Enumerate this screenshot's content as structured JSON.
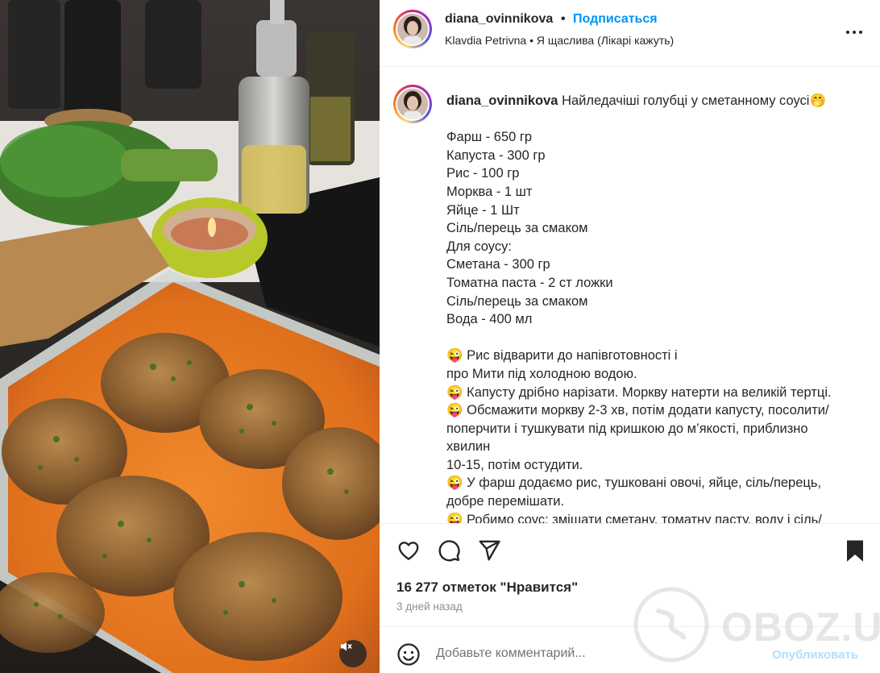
{
  "header": {
    "username": "diana_ovinnikova",
    "separator": "•",
    "follow_label": "Подписаться",
    "audio_artist": "Klavdia Petrivna",
    "audio_separator": "•",
    "audio_title": "Я щаслива (Лікарі кажуть)",
    "more_icon": "more-horizontal-icon"
  },
  "caption": {
    "username": "diana_ovinnikova",
    "title": "Найледачіші голубці у сметанному соусі🤭",
    "text": "Фарш - 650 гр\nКапуста - 300 гр\nРис - 100 гр\nМорква - 1 шт\nЯйце - 1 Шт\nСіль/перець за смаком\nДля соусу:\nСметана - 300 гр\nТоматна паста - 2 ст ложки\nСіль/перець за смаком\nВода - 400 мл\n\n😜 Рис відварити до напівготовності і\nпро Мити під холодною водою.\n😜 Капусту дрібно нарізати. Моркву натерти на великій тертці.\n😜 Обсмажити моркву 2-3 хв, потім додати капусту, посолити/\nпоперчити і тушкувати під кришкою до м’якості, приблизно\nхвилин\n10-15, потім остудити.\n😜 У фарш додаємо рис, тушковані овочі, яйце, сіль/перець,\nдобре перемішати.\n😜 Робимо соус: змішати сметану, томатну пасту, воду і сіль/"
  },
  "actions": {
    "like_icon": "heart-icon",
    "comment_icon": "comment-icon",
    "share_icon": "share-icon",
    "save_icon": "bookmark-icon",
    "likes_text": "16 277 отметок \"Нравится\"",
    "time_text": "3 дней назад"
  },
  "comment": {
    "emoji_icon": "emoji-icon",
    "placeholder": "Добавьте комментарий...",
    "publish_label": "Опубликовать"
  },
  "media": {
    "mute_icon": "speaker-muted-icon"
  },
  "watermark": {
    "text": "OBOZ.UA"
  },
  "colors": {
    "link_blue": "#0095f6",
    "publish_disabled": "#b2dffc",
    "muted_text": "#8e8e8e",
    "sauce_orange": "#e0701c"
  }
}
